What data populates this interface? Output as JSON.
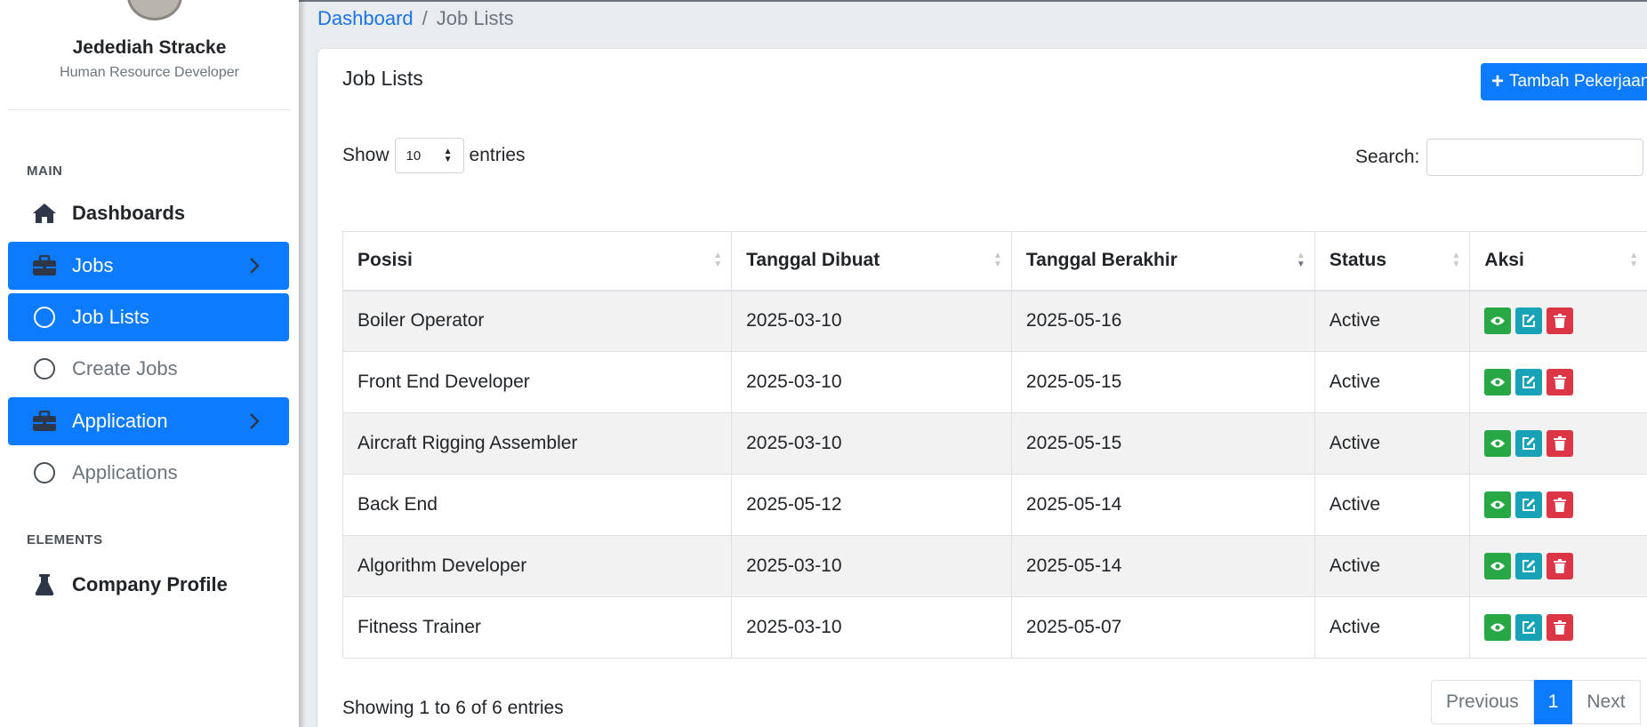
{
  "user": {
    "name": "Jedediah Stracke",
    "role": "Human Resource Developer"
  },
  "sidebar": {
    "section_main": "MAIN",
    "section_elements": "ELEMENTS",
    "items": [
      {
        "label": "Dashboards",
        "icon": "home-icon"
      },
      {
        "label": "Jobs",
        "icon": "briefcase-icon"
      },
      {
        "label": "Job Lists",
        "icon": "circle-icon"
      },
      {
        "label": "Create Jobs",
        "icon": "circle-icon"
      },
      {
        "label": "Application",
        "icon": "briefcase-icon"
      },
      {
        "label": "Applications",
        "icon": "circle-icon"
      },
      {
        "label": "Company Profile",
        "icon": "flask-icon"
      }
    ]
  },
  "breadcrumb": {
    "home": "Dashboard",
    "separator": "/",
    "current": "Job Lists"
  },
  "card": {
    "title": "Job Lists",
    "add_button": "Tambah Pekerjaan"
  },
  "controls": {
    "show_label": "Show",
    "entries_value": "10",
    "entries_label": "entries",
    "search_label": "Search:",
    "search_value": ""
  },
  "table": {
    "headers": [
      "Posisi",
      "Tanggal Dibuat",
      "Tanggal Berakhir",
      "Status",
      "Aksi"
    ],
    "rows": [
      [
        "Boiler Operator",
        "2025-03-10",
        "2025-05-16",
        "Active"
      ],
      [
        "Front End Developer",
        "2025-03-10",
        "2025-05-15",
        "Active"
      ],
      [
        "Aircraft Rigging Assembler",
        "2025-03-10",
        "2025-05-15",
        "Active"
      ],
      [
        "Back End",
        "2025-05-12",
        "2025-05-14",
        "Active"
      ],
      [
        "Algorithm Developer",
        "2025-03-10",
        "2025-05-14",
        "Active"
      ],
      [
        "Fitness Trainer",
        "2025-03-10",
        "2025-05-07",
        "Active"
      ]
    ]
  },
  "footer": {
    "info": "Showing 1 to 6 of 6 entries",
    "previous": "Previous",
    "current_page": "1",
    "next": "Next"
  },
  "colors": {
    "primary": "#0d7bff",
    "view": "#28a745",
    "edit": "#17a2b8",
    "delete": "#dc3545"
  }
}
